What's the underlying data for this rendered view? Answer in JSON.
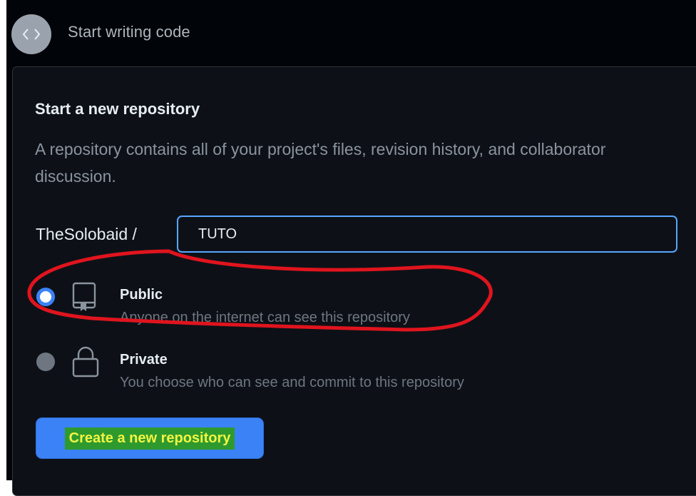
{
  "header": {
    "title": "Start writing code",
    "icon": "code-icon"
  },
  "new_repo": {
    "title": "Start a new repository",
    "description": "A repository contains all of your project's files, revision history, and collaborator discussion.",
    "owner_label": "TheSolobaid /",
    "name_value": "TUTO"
  },
  "visibility": {
    "public": {
      "label": "Public",
      "description": "Anyone on the internet can see this repository",
      "icon": "repo-icon",
      "selected": true
    },
    "private": {
      "label": "Private",
      "description": "You choose who can see and commit to this repository",
      "icon": "lock-icon",
      "selected": false
    }
  },
  "create_button": {
    "label": "Create a new repository"
  },
  "colors": {
    "background": "#010409",
    "card": "#0d1117",
    "accent": "#3b82f6",
    "annotation": "#e0141e",
    "label_highlight_bg": "#2e9a2e",
    "label_highlight_text": "#f2f542"
  }
}
